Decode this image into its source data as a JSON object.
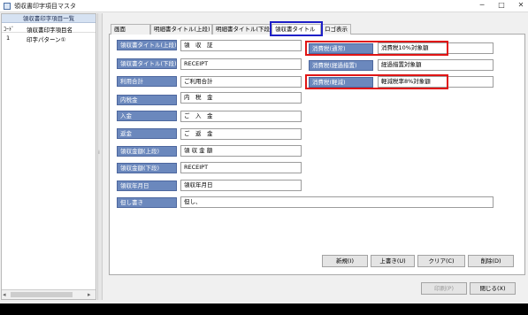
{
  "window": {
    "title": "領収書印字項目マスタ",
    "minimize": "─",
    "maximize": "□",
    "close": "✕"
  },
  "left_pane": {
    "header": "領収書印字項目一覧",
    "columns": {
      "code": "ｺｰﾄﾞ",
      "name": "領収書印字項目名"
    },
    "rows": [
      {
        "code": "1",
        "name": "印字パターン①"
      }
    ],
    "scroll_left": "◂",
    "scroll_right": "▸"
  },
  "splitter_grip": "⁞",
  "tabs": [
    {
      "label": "画面"
    },
    {
      "label": "明細書タイトル(上段)"
    },
    {
      "label": "明細書タイトル(下段)"
    },
    {
      "label": "領収書タイトル"
    },
    {
      "label": "ロゴ表示"
    }
  ],
  "active_tab": "領収書タイトル",
  "fields": [
    {
      "label": "領収書タイトル(上段)",
      "value": "領　収　証"
    },
    {
      "label": "領収書タイトル(下段)",
      "value": "RECEIPT"
    },
    {
      "label": "利用合計",
      "value": "ご利用合計"
    },
    {
      "label": "内税金",
      "value": "内　税　金"
    },
    {
      "label": "入金",
      "value": "ご　入　金"
    },
    {
      "label": "返金",
      "value": "ご　返　金"
    },
    {
      "label": "領収金額(上段)",
      "value": "領 収 金 額"
    },
    {
      "label": "領収金額(下段)",
      "value": "RECEIPT"
    },
    {
      "label": "領収年月日",
      "value": "領収年月日"
    },
    {
      "label": "但し書き",
      "value": "但し、"
    }
  ],
  "tax_fields": [
    {
      "label": "消費税(通常)",
      "value": "消費税10%対象額",
      "highlighted": true
    },
    {
      "label": "消費税(経過措置)",
      "value": "経過措置対象額",
      "highlighted": false
    },
    {
      "label": "消費税(軽減)",
      "value": "軽減税率8%対象額",
      "highlighted": true
    }
  ],
  "buttons": {
    "new": "新規(I)",
    "overwrite": "上書き(U)",
    "clear": "クリア(C)",
    "delete": "削除(D)",
    "print": "印刷(P)",
    "close": "閉じる(X)"
  },
  "colors": {
    "label_blue": "#6b88bd",
    "highlight_red": "#e01515",
    "highlight_blue": "#1e20c8"
  }
}
